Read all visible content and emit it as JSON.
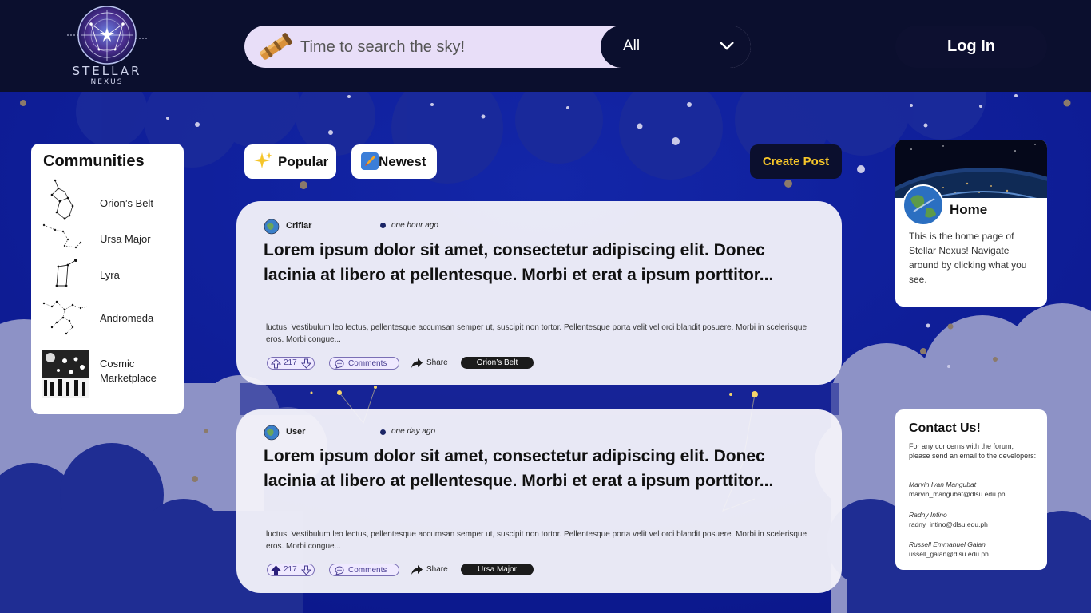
{
  "app": {
    "logo_text": "STELLAR",
    "logo_subtext": "NEXUS"
  },
  "header": {
    "search_placeholder": "Time to search the sky!",
    "filter_selected": "All",
    "login_label": "Log In"
  },
  "communities": {
    "title": "Communities",
    "items": [
      {
        "label": "Orion’s Belt",
        "icon": "orion-constellation-icon"
      },
      {
        "label": "Ursa Major",
        "icon": "ursa-major-constellation-icon"
      },
      {
        "label": "Lyra",
        "icon": "lyra-constellation-icon"
      },
      {
        "label": "Andromeda",
        "icon": "andromeda-constellation-icon"
      },
      {
        "label": "Cosmic Marketplace",
        "icon": "marketplace-image"
      }
    ]
  },
  "sort": {
    "popular_label": "Popular",
    "newest_label": "Newest",
    "create_label": "Create Post"
  },
  "posts": [
    {
      "author": "Criflar",
      "time": "one hour ago",
      "title": "Lorem ipsum dolor sit amet, consectetur adipiscing elit. Donec lacinia at libero at pellentesque. Morbi et erat a ipsum porttitor...",
      "body": "luctus. Vestibulum leo lectus, pellentesque accumsan semper ut, suscipit non tortor. Pellentesque porta velit vel orci blandit posuere. Morbi in scelerisque eros. Morbi congue...",
      "votes": "217",
      "comments_label": "Comments",
      "share_label": "Share",
      "tag": "Orion’s Belt",
      "upvoted": false
    },
    {
      "author": "User",
      "time": "one day ago",
      "title": "Lorem ipsum dolor sit amet, consectetur adipiscing elit. Donec lacinia at libero at pellentesque. Morbi et erat a ipsum porttitor...",
      "body": "luctus. Vestibulum leo lectus, pellentesque accumsan semper ut, suscipit non tortor. Pellentesque porta velit vel orci blandit posuere. Morbi in scelerisque eros. Morbi congue...",
      "votes": "217",
      "comments_label": "Comments",
      "share_label": "Share",
      "tag": "Ursa Major",
      "upvoted": true
    }
  ],
  "home": {
    "title": "Home",
    "description": "This is the home page of Stellar Nexus! Navigate around by clicking what you see."
  },
  "contact": {
    "title": "Contact Us!",
    "intro": "For any concerns with the forum, please send an email to the developers:",
    "developers": [
      {
        "name": "Marvin Ivan Mangubat",
        "email": "marvin_mangubat@dlsu.edu.ph"
      },
      {
        "name": "Radny Intino",
        "email": "radny_intino@dlsu.edu.ph"
      },
      {
        "name": "Russell Emmanuel Galan",
        "email": "ussell_galan@dlsu.edu.ph"
      }
    ]
  },
  "colors": {
    "header_bg": "#0b0f2e",
    "sky_bg": "#0e1a8c",
    "cloud_dark": "#1d2b8f",
    "cloud_light": "#8a8fc4",
    "search_bg": "#e8def8",
    "accent_gold": "#f5c52a",
    "tag_bg": "#1b1b1b"
  }
}
